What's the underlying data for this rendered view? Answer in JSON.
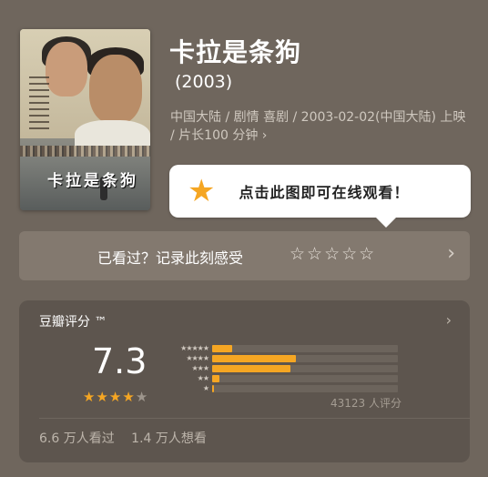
{
  "movie": {
    "title": "卡拉是条狗",
    "year": "(2003)",
    "meta": "中国大陆 / 剧情 喜剧 / 2003-02-02(中国大陆) 上映 / 片长100 分钟",
    "meta_chevron": "›",
    "poster_title": "卡拉是条狗"
  },
  "watch_tip": {
    "icon": "star-icon",
    "label": "点击此图即可在线观看！"
  },
  "record": {
    "label": "已看过？记录此刻感受",
    "stars": "☆☆☆☆☆",
    "chevron": "›"
  },
  "rating": {
    "title": "豆瓣评分 ™",
    "chevron": "›",
    "score": "7.3",
    "stars_filled": 3.5,
    "distribution": [
      {
        "stars": "★★★★★",
        "fraction": 0.11
      },
      {
        "stars": "★★★★",
        "fraction": 0.45
      },
      {
        "stars": "★★★",
        "fraction": 0.42
      },
      {
        "stars": "★★",
        "fraction": 0.04
      },
      {
        "stars": "★",
        "fraction": 0.01
      }
    ],
    "count": "43123 人评分",
    "watched": "6.6 万人看过",
    "want": "1.4 万人想看"
  },
  "colors": {
    "background": "#6f665d",
    "accent": "#f5a623",
    "card": "#5d554e"
  }
}
